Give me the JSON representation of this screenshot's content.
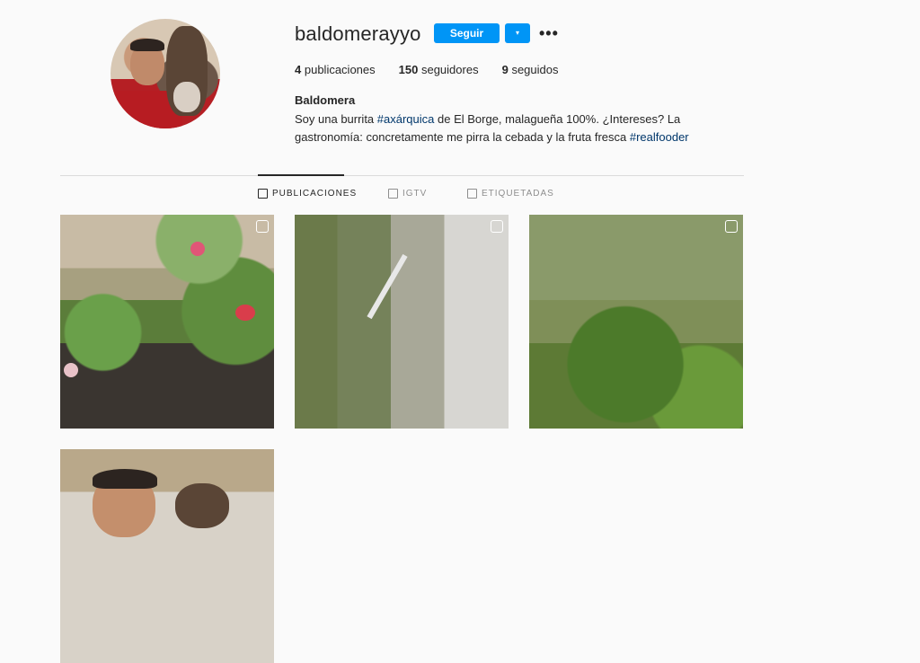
{
  "profile": {
    "username": "baldomerayyo",
    "follow_label": "Seguir",
    "dropdown_icon": "▾",
    "more_icon": "•••",
    "stats": [
      {
        "count": "4",
        "label": "publicaciones"
      },
      {
        "count": "150",
        "label": "seguidores"
      },
      {
        "count": "9",
        "label": "seguidos"
      }
    ],
    "full_name": "Baldomera",
    "bio": {
      "part1": "Soy una burrita ",
      "tag1": "#axárquica",
      "part2": " de El Borge, malagueña 100%. ¿Intereses? La gastronomía: concretamente me pirra la cebada y la fruta fresca ",
      "tag2": "#realfooder"
    }
  },
  "tabs": [
    {
      "label": "PUBLICACIONES",
      "icon": "grid-icon"
    },
    {
      "label": "IGTV",
      "icon": "tv-icon"
    },
    {
      "label": "ETIQUETADAS",
      "icon": "tagged-icon"
    }
  ],
  "colors": {
    "accent": "#0095f6",
    "hashtag": "#00376b",
    "background": "#fafafa"
  }
}
